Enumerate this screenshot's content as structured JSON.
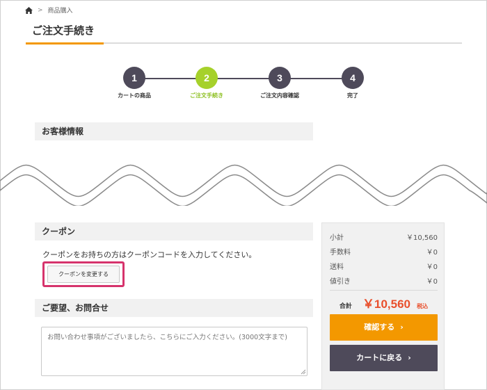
{
  "breadcrumb": {
    "separator": ">",
    "current": "商品購入"
  },
  "page_title": "ご注文手続き",
  "steps": [
    {
      "number": "1",
      "label": "カートの商品"
    },
    {
      "number": "2",
      "label": "ご注文手続き"
    },
    {
      "number": "3",
      "label": "ご注文内容確認"
    },
    {
      "number": "4",
      "label": "完了"
    }
  ],
  "active_step": 2,
  "customer_section": {
    "title": "お客様情報"
  },
  "coupon_section": {
    "title": "クーポン",
    "description": "クーポンをお持ちの方はクーポンコードを入力してください。",
    "button_label": "クーポンを変更する"
  },
  "inquiry_section": {
    "title": "ご要望、お問合せ",
    "placeholder": "お問い合わせ事項がございましたら、こちらにご入力ください。(3000文字まで)"
  },
  "summary": {
    "rows": [
      {
        "label": "小計",
        "value": "￥10,560"
      },
      {
        "label": "手数料",
        "value": "￥0"
      },
      {
        "label": "送料",
        "value": "￥0"
      },
      {
        "label": "値引き",
        "value": "￥0"
      }
    ],
    "total_label": "合計",
    "total_value": "￥10,560",
    "tax_note": "税込",
    "confirm_label": "確認する",
    "back_label": "カートに戻る"
  },
  "colors": {
    "accent_orange": "#f39800",
    "step_active": "#a6d12b",
    "step_dark": "#4e4a5a",
    "price_red": "#e94f2c",
    "highlight_pink": "#d6336c"
  }
}
